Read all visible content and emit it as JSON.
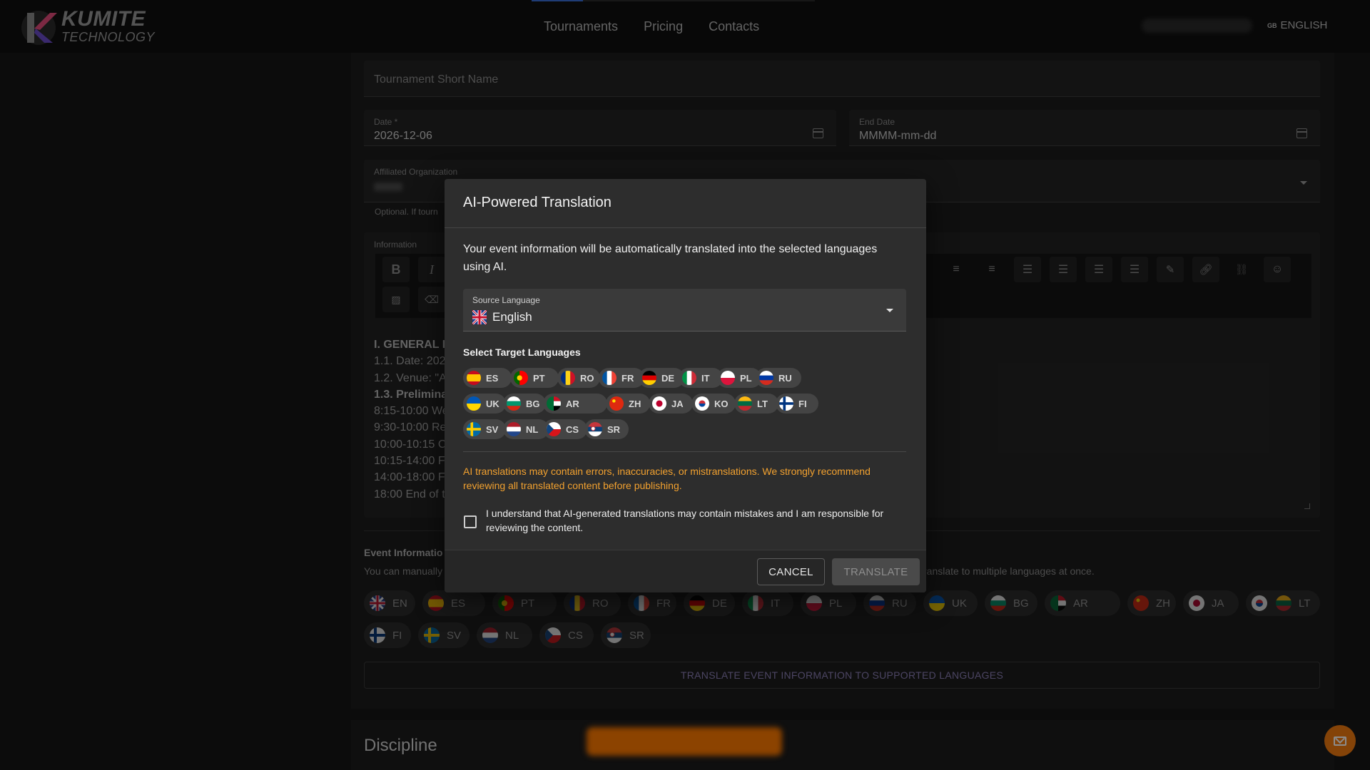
{
  "header": {
    "logo_line1": "KUMITE",
    "logo_line2": "TECHNOLOGY",
    "nav": [
      "Tournaments",
      "Pricing",
      "Contacts"
    ],
    "language_code": "GB",
    "language_label": "ENGLISH"
  },
  "form": {
    "short_name_placeholder": "Tournament Short Name",
    "date_label": "Date *",
    "date_value": "2026-12-06",
    "end_date_label": "End Date",
    "end_date_placeholder": "MMMM-mm-dd",
    "affiliated_label": "Affiliated Organization",
    "affiliated_hint": "Optional. If tourn",
    "information_label": "Information",
    "editor_lines": [
      "I. GENERAL II",
      "1.1. Date: 202",
      "1.2. Venue: \"A",
      "1.3. Prelimina",
      "8:15-10:00 We",
      "9:30-10:00 Re",
      "10:00-10:15 C",
      "10:15-14:00 F",
      "14:00-18:00 F",
      "18:00 End of t"
    ],
    "event_info_title": "Event Informatio",
    "event_info_desc_left": "You can manually",
    "event_info_desc_right": "ranslate to multiple languages at once.",
    "translate_all_button": "TRANSLATE EVENT INFORMATION TO SUPPORTED LANGUAGES",
    "discipline_title": "Discipline",
    "languages": [
      "EN",
      "ES",
      "PT",
      "RO",
      "FR",
      "DE",
      "IT",
      "PL",
      "RU",
      "UK",
      "BG",
      "AR",
      "ZH",
      "JA",
      "KO",
      "LT",
      "FI",
      "SV",
      "NL",
      "CS",
      "SR"
    ]
  },
  "modal": {
    "title": "AI-Powered Translation",
    "description": "Your event information will be automatically translated into the selected languages using AI.",
    "source_label": "Source Language",
    "source_value": "English",
    "target_title": "Select Target Languages",
    "targets": [
      "ES",
      "PT",
      "RO",
      "FR",
      "DE",
      "IT",
      "PL",
      "RU",
      "UK",
      "BG",
      "AR",
      "ZH",
      "JA",
      "KO",
      "LT",
      "FI",
      "SV",
      "NL",
      "CS",
      "SR"
    ],
    "warning": "AI translations may contain errors, inaccuracies, or mistranslations. We strongly recommend reviewing all translated content before publishing.",
    "checkbox_label": "I understand that AI-generated translations may contain mistakes and I am responsible for reviewing the content.",
    "checkbox_checked": false,
    "cancel_label": "CANCEL",
    "translate_label": "TRANSLATE"
  },
  "colors": {
    "accent_orange": "#f07a10",
    "warning_text": "#f2a12f",
    "nav_active": "#3a6dd8"
  }
}
